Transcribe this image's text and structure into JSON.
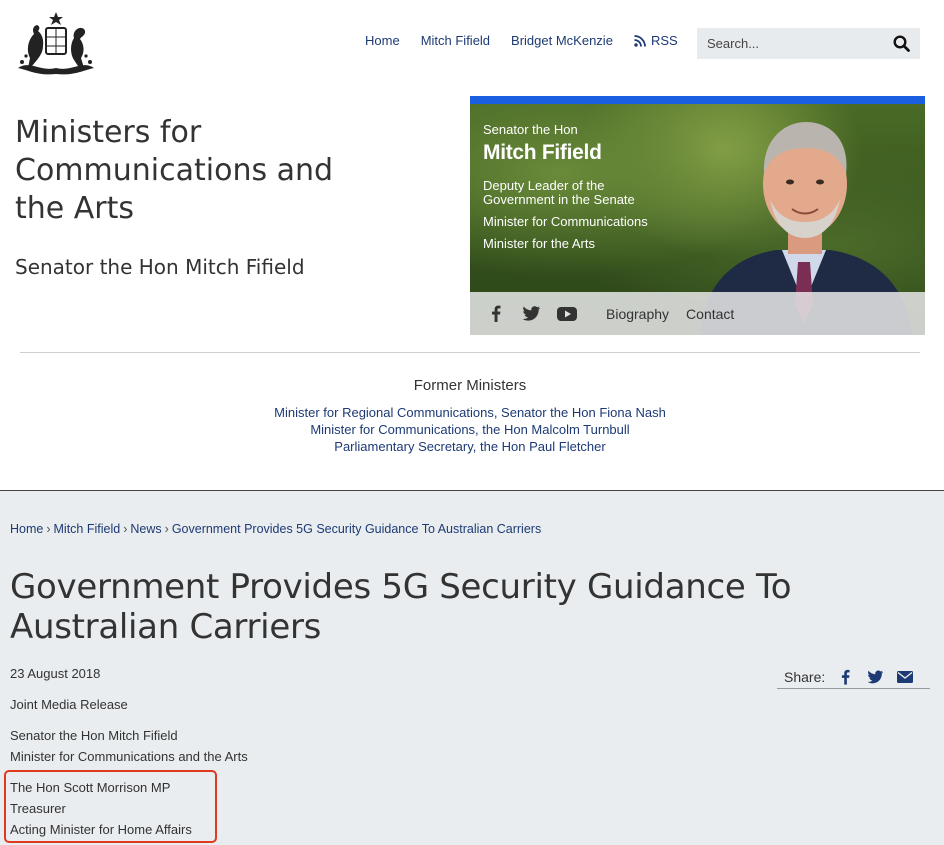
{
  "nav": {
    "items": [
      "Home",
      "Mitch Fifield",
      "Bridget McKenzie"
    ],
    "rss_label": "RSS"
  },
  "search": {
    "placeholder": "Search..."
  },
  "site": {
    "title": "Ministers for Communications and the Arts",
    "subtitle": "Senator the Hon Mitch Fifield"
  },
  "hero": {
    "pre_title": "Senator the Hon",
    "name": "Mitch Fifield",
    "roles": [
      "Deputy Leader of the Government in the Senate",
      "Minister for Communications",
      "Minister for the Arts"
    ],
    "links": [
      "Biography",
      "Contact"
    ]
  },
  "former_ministers": {
    "heading": "Former Ministers",
    "links": [
      "Minister for Regional Communications, Senator the Hon Fiona Nash",
      "Minister for Communications, the Hon Malcolm Turnbull",
      "Parliamentary Secretary, the Hon Paul Fletcher"
    ]
  },
  "breadcrumb": {
    "items": [
      "Home",
      "Mitch Fifield",
      "News"
    ],
    "current": "Government Provides 5G Security Guidance To Australian Carriers",
    "separator": "›"
  },
  "article": {
    "title": "Government Provides 5G Security Guidance To Australian Carriers",
    "date": "23 August 2018",
    "release_type": "Joint Media Release",
    "lines": [
      "Senator the Hon Mitch Fifield",
      "Minister for Communications and the Arts",
      "The Hon Scott Morrison MP",
      "Treasurer",
      "Acting Minister for Home Affairs"
    ]
  },
  "share": {
    "label": "Share:"
  },
  "colors": {
    "link": "#1d3a75",
    "accent_bar": "#1a5fe0",
    "highlight": "#e03a1e",
    "main_bg": "#e9edef"
  },
  "icons": [
    "crest-icon",
    "rss-icon",
    "search-icon",
    "facebook-icon",
    "twitter-icon",
    "youtube-icon",
    "email-icon"
  ]
}
